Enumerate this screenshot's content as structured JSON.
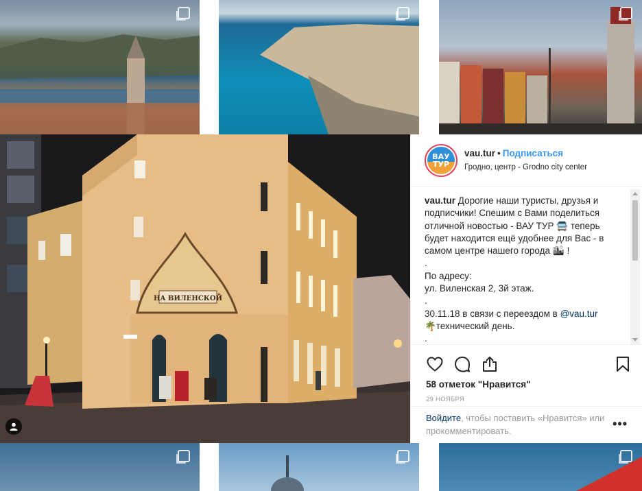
{
  "post": {
    "username": "vau.tur",
    "separator": "•",
    "follow_label": "Подписаться",
    "location": "Гродно, центр - Grodno city center",
    "avatar_text_top": "ВАУ",
    "avatar_text_bottom": "ТУР",
    "caption": {
      "author": "vau.tur",
      "lines": [
        "Дорогие наши туристы, друзья и подписчики! Спешим с Вами поделиться отличной новостью - ВАУ ТУР 🚍 теперь будет находится ещё удобнее для Вас - в самом центре нашего города 🏙 !",
        ".",
        "По адресу:",
        "ул. Виленская 2, 3й этаж.",
        ".",
        "30.11.18 в связи с переездом в",
        "🌴технический день.",
        "."
      ],
      "mention": "@vau.tur"
    },
    "likes": "58 отметок \"Нравится\"",
    "date": "29 НОЯБРЯ",
    "login_link": "Войдите",
    "login_text": ", чтобы поставить «Нравится» или прокомментировать.",
    "more_label": "•••"
  },
  "photo_sign": "НА ВИЛЕНСКОЙ",
  "icons": {
    "like": "heart-icon",
    "comment": "comment-icon",
    "share": "share-icon",
    "save": "bookmark-icon",
    "user_tag": "user-icon",
    "multi": "multiple-photos-icon"
  },
  "colors": {
    "follow": "#3897f0",
    "text": "#262626",
    "muted": "#999999",
    "link": "#003569",
    "avatar_ring": "#e4405f"
  }
}
